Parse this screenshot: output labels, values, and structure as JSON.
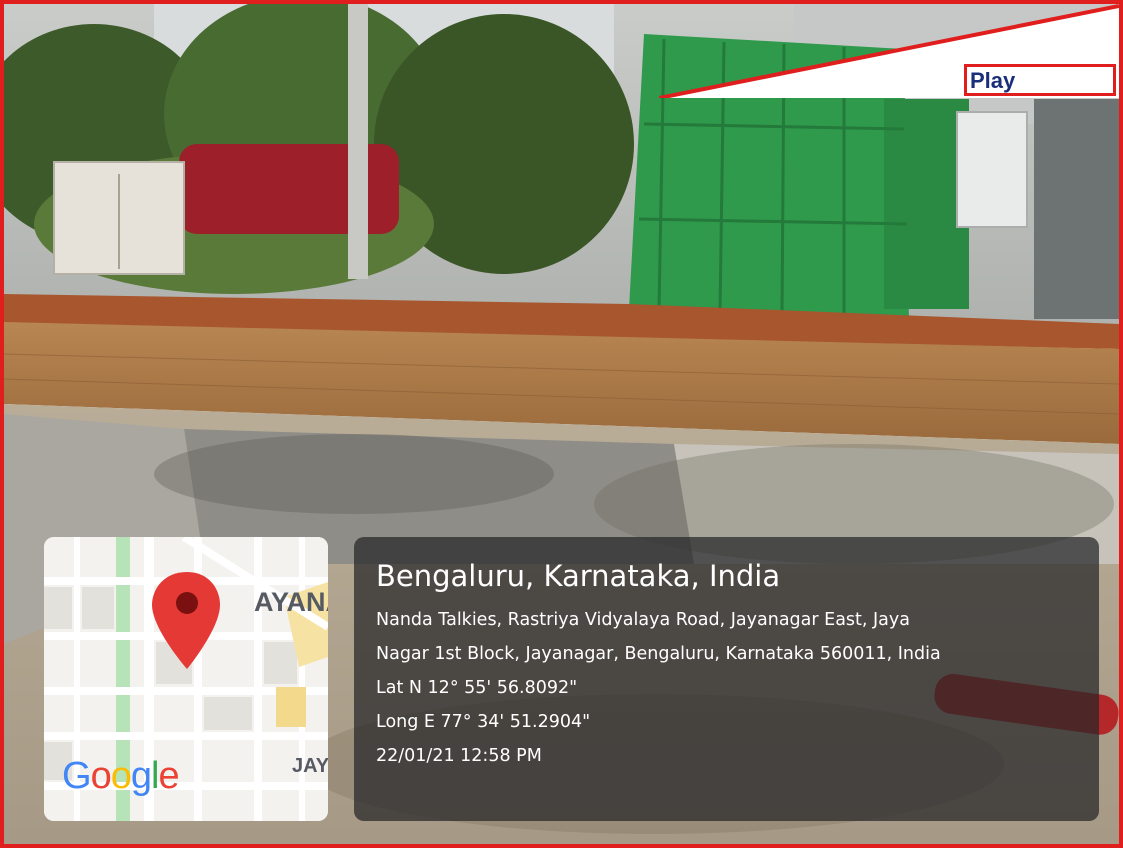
{
  "overlay": {
    "play_label": "Play"
  },
  "map": {
    "label_top": "AYANA",
    "label_bottom": "JAY",
    "logo_letters": [
      {
        "char": "G",
        "color": "#4285f4"
      },
      {
        "char": "o",
        "color": "#ea4335"
      },
      {
        "char": "o",
        "color": "#fbbc05"
      },
      {
        "char": "g",
        "color": "#4285f4"
      },
      {
        "char": "l",
        "color": "#34a853"
      },
      {
        "char": "e",
        "color": "#ea4335"
      }
    ],
    "pin_color": "#e53935"
  },
  "location": {
    "city": "Bengaluru, Karnataka, India",
    "address_line1": "Nanda Talkies, Rastriya Vidyalaya Road, Jayanagar East, Jaya",
    "address_line2": "Nagar 1st Block, Jayanagar, Bengaluru, Karnataka 560011, India",
    "latitude": "Lat N 12° 55' 56.8092\"",
    "longitude": "Long E 77° 34' 51.2904\"",
    "timestamp": "22/01/21 12:58 PM"
  },
  "colors": {
    "frame_border": "#e01e1e",
    "play_text": "#1a2f7a"
  }
}
